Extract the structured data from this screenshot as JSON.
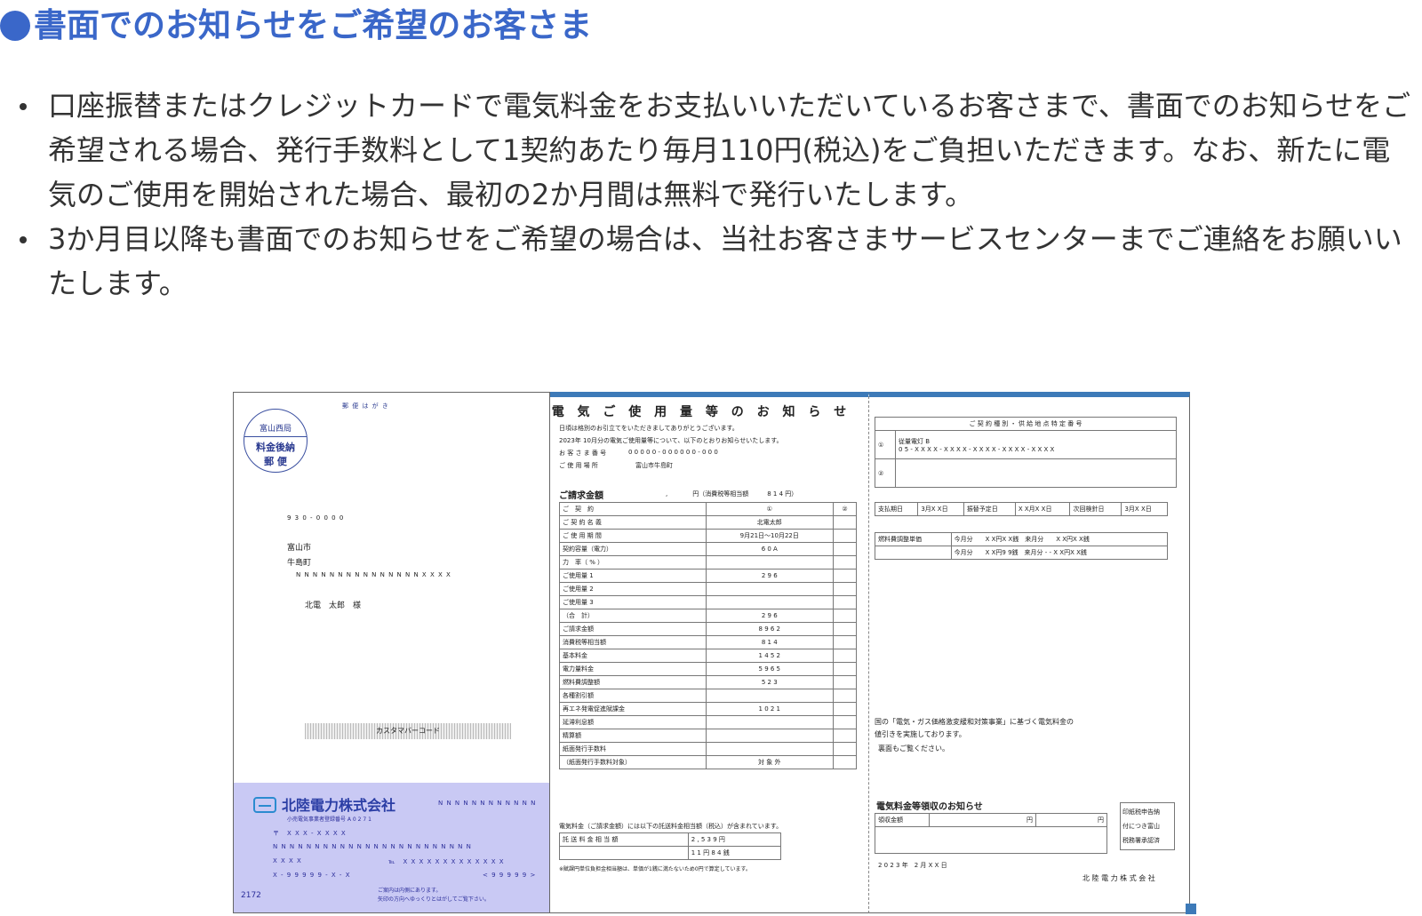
{
  "heading": "●書面でのお知らせをご希望のお客さま",
  "notes": [
    "口座振替またはクレジットカードで電気料金をお支払いいただいているお客さまで、書面でのお知らせをご希望される場合、発行手数料として1契約あたり毎月110円(税込)をご負担いただきます。なお、新たに電気のご使用を開始された場合、最初の2か月間は無料で発行いたします。",
    "3か月目以降も書面でのお知らせをご希望の場合は、当社お客さまサービスセンターまでご連絡をお願いいたします。"
  ],
  "postcard": {
    "header": "郵 便 は が き",
    "stamp_office": "富山西局",
    "stamp_line1": "料金後納",
    "stamp_line2": "郵 便",
    "zip": "9 3 0 - 0 0 0 0",
    "addr1": "富山市",
    "addr2": "牛島町",
    "addr3": "N N N N N N N N N N N N N N N X X X X",
    "name": "北電　太郎　様",
    "barcode_label": "カスタマバーコード",
    "company": "北陸電力株式会社",
    "company_code": "N N N N N N N N N N N N",
    "license": "小売電気事業者登録番号 A 0 2 7 1",
    "f1": "〒　X X X - X X X X",
    "f2": "N N N N N N N N N N N N N N N N N N N N N N N N",
    "f3": "X X X X",
    "f3b": "℡　X X X X X X X X X X X X X",
    "f4": "X - 9 9 9 9 9 - X - X",
    "f4b": "< 9 9 9 9 9 >",
    "num": "2172",
    "notice1": "ご案内は内側にあります。",
    "notice2": "矢印の方向へゆっくりとはがしてご覧下さい。"
  },
  "bill": {
    "title": "電 気 ご 使 用 量 等 の お 知 ら せ",
    "greeting": "日頃は格別のお引立てをいただきましてありがとうございます。",
    "period_text": "2023年 10月分の電気ご使用量等について、以下のとおりお知らせいたします。",
    "customer_no_label": "お 客 さ ま 番 号",
    "customer_no": "0 0 0 0 0 - 0 0 0 0 0 0 - 0 0 0",
    "place_label": "ご 使 用 場 所",
    "place": "富山市牛島町",
    "billing_label": "ご請求金額",
    "billing_amount": ",　　　　円（消費税等相当額　　　8 1 4 円）",
    "rows": [
      [
        "ご　契　約",
        "①",
        "②"
      ],
      [
        "ご 契 約 名 義",
        "北電太郎",
        ""
      ],
      [
        "ご 使 用 期 間",
        "9月21日〜10月22日",
        ""
      ],
      [
        "契約容量（電力）",
        "6 0 A",
        ""
      ],
      [
        "力　率（ % ）",
        "",
        ""
      ],
      [
        "ご使用量 1",
        "2 9 6",
        ""
      ],
      [
        "ご使用量 2",
        "",
        ""
      ],
      [
        "ご使用量 3",
        "",
        ""
      ],
      [
        "（合　計）",
        "2 9 6",
        ""
      ],
      [
        "ご請求金額",
        "8 9 6 2",
        ""
      ],
      [
        "消費税等相当額",
        "8 1 4",
        ""
      ],
      [
        "基本料金",
        "1 4 5 2",
        ""
      ],
      [
        "電力量料金",
        "5 9 6 5",
        ""
      ],
      [
        "燃料費調整額",
        "5 2 3",
        ""
      ],
      [
        "各種割引額",
        "",
        ""
      ],
      [
        "再エネ発電促進賦課金",
        "1 0 2 1",
        ""
      ],
      [
        "延滞利息額",
        "",
        ""
      ],
      [
        "精算額",
        "",
        ""
      ],
      [
        "紙面発行手数料",
        "",
        ""
      ],
      [
        "（紙面発行手数料対象）",
        "対 象 外",
        ""
      ]
    ],
    "tax_note": "電気料金（ご請求金額）には以下の託送料金相当額（税込）が含まれています。",
    "tax_row1_label": "託 送 料 金 相 当 額",
    "tax_row1_val": "2 , 5 3 9 円",
    "tax_row2_val": "1 1 円 8 4 銭",
    "footnote": "※賦課円単位負担金相当額は、単価が1銭に満たないため0円で算定しています。"
  },
  "right": {
    "contract_header": "ご 契 約 種 別 ・ 供 給 地 点 特 定 番 号",
    "contract_type": "従量電灯 B",
    "point_no": "0 5 - X X X X - X X X X - X X X X - X X X X - X X X X",
    "pay_row": [
      "支払期日",
      "3月X X日",
      "振替予定日",
      "X X月X X日",
      "次回検針日",
      "3月X X日"
    ],
    "fuel1": "燃料費調整単価",
    "fuel1a": "今月分　　X X円X X銭　来月分　　X X円X X銭",
    "fuel2a": "今月分　　X X円9 9銭　来月分 - - X X円X X銭",
    "note1": "国の「電気・ガス価格激変緩和対策事業」に基づく電気料金の",
    "note2": "値引きを実施しております。",
    "note3": "裏面もご覧ください。",
    "receipt_title": "電気料金等領収のお知らせ",
    "receipt_label": "領収金額",
    "receipt_yen": "円",
    "stamp_text1": "印紙税申告納",
    "stamp_text2": "付につき富山",
    "stamp_text3": "税務署承認済",
    "date": "2 0 2 3 年　2 月 X X 日",
    "company": "北 陸 電 力 株 式 会 社"
  }
}
